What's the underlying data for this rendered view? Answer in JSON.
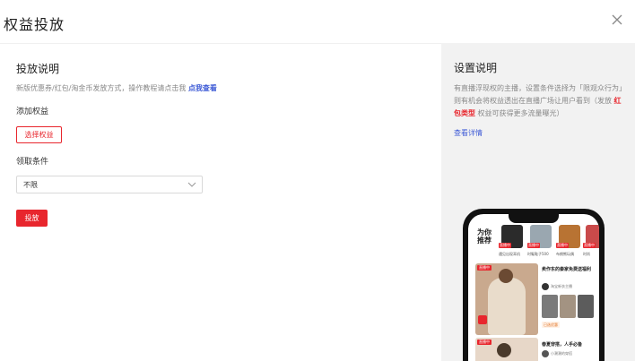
{
  "modal": {
    "title": "权益投放"
  },
  "left": {
    "section_title": "投放说明",
    "description": "新版优惠券/红包/淘金币发放方式，操作教程请点击我 ",
    "description_link": "点我查看",
    "add_label": "添加权益",
    "select_benefit_button": "选择权益",
    "condition_label": "领取条件",
    "condition_value": "不限",
    "submit_button": "投放"
  },
  "right": {
    "section_title": "设置说明",
    "desc_part1": "有直播浮现权的主播，设置条件选择为「限观众行为」则有机会将权益透出在直播广场让用户看到（发放 ",
    "desc_highlight": "红包类型",
    "desc_part2": " 权益可获得更多流量曝光）",
    "detail_link": "查看详情"
  },
  "phone_preview": {
    "title": "为你推荐",
    "products": [
      {
        "caption": "遇见出现耳机",
        "tag": "直播中",
        "color": "#2b2b2b"
      },
      {
        "caption": "时髦鞋子500",
        "tag": "直播中",
        "color": "#9aa7b0"
      },
      {
        "caption": "布朗熊玩偶",
        "tag": "直播中",
        "color": "#b87333"
      },
      {
        "caption": "时尚",
        "tag": "直播中",
        "color": "#c94a4a"
      }
    ],
    "card1_badge": "直播中",
    "card1_title": "卖作东的秦家免费送福利",
    "card1_user": "淘宝新衣主播",
    "card1_coupon": "已选优惠",
    "card2_badge": "直播中",
    "card2_title": "春夏穿搭，人手必备",
    "card2_user": "小潮潮的穿搭"
  }
}
